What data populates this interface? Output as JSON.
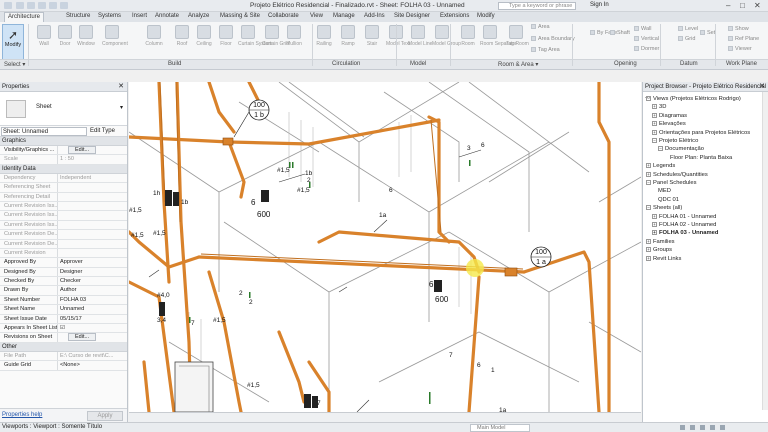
{
  "window": {
    "title": "Projeto Elétrico Residencial - Finalizado.rvt - Sheet: FOLHA 03 - Unnamed",
    "search_placeholder": "Type a keyword or phrase",
    "user": "Sign In"
  },
  "tabs": [
    "Architecture",
    "Structure",
    "Systems",
    "Insert",
    "Annotate",
    "Analyze",
    "Massing & Site",
    "Collaborate",
    "View",
    "Manage",
    "Add-Ins",
    "Site Designer",
    "Extensions",
    "Modify"
  ],
  "active_tab": "Architecture",
  "ribbon": {
    "modify_label": "Modify",
    "tools": [
      "Wall",
      "Door",
      "Window",
      "Component",
      "Column",
      "Roof",
      "Ceiling",
      "Floor",
      "Curtain System",
      "Curtain Grid",
      "Mullion",
      "Railing",
      "Ramp",
      "Stair",
      "Model Text",
      "Model Line",
      "Model Group",
      "Room",
      "Room Separator",
      "Tag Room",
      "Area",
      "Area Boundary",
      "Tag Area",
      "By Face",
      "Shaft",
      "Wall",
      "Vertical",
      "Dormer",
      "Level",
      "Grid",
      "Set",
      "Show",
      "Ref Plane",
      "Viewer"
    ],
    "group_labels": [
      "Select ▾",
      "Build",
      "Circulation",
      "Model",
      "Room & Area ▾",
      "Opening",
      "Datum",
      "Work Plane"
    ]
  },
  "properties": {
    "header": "Properties",
    "type_name": "Sheet",
    "selector": "Sheet: Unnamed",
    "edit_type": "Edit Type",
    "sections": {
      "graphics": "Graphics",
      "identity": "Identity Data",
      "other": "Other"
    },
    "graphics_rows": [
      {
        "key": "Visibility/Graphics ...",
        "value": "",
        "button": "Edit..."
      },
      {
        "key": "Scale",
        "value": "1 : 50",
        "dim": true
      }
    ],
    "identity_rows": [
      {
        "key": "Dependency",
        "value": "Independent",
        "dim": true
      },
      {
        "key": "Referencing Sheet",
        "value": "",
        "dim": true
      },
      {
        "key": "Referencing Detail",
        "value": "",
        "dim": true
      },
      {
        "key": "Current Revision Iss...",
        "value": "",
        "dim": true
      },
      {
        "key": "Current Revision Iss...",
        "value": "",
        "dim": true
      },
      {
        "key": "Current Revision Iss...",
        "value": "",
        "dim": true
      },
      {
        "key": "Current Revision De...",
        "value": "",
        "dim": true
      },
      {
        "key": "Current Revision De...",
        "value": "",
        "dim": true
      },
      {
        "key": "Current Revision",
        "value": "",
        "dim": true
      },
      {
        "key": "Approved By",
        "value": "Approver"
      },
      {
        "key": "Designed By",
        "value": "Designer"
      },
      {
        "key": "Checked By",
        "value": "Checker"
      },
      {
        "key": "Drawn By",
        "value": "Author"
      },
      {
        "key": "Sheet Number",
        "value": "FOLHA 03"
      },
      {
        "key": "Sheet Name",
        "value": "Unnamed"
      },
      {
        "key": "Sheet Issue Date",
        "value": "05/15/17"
      },
      {
        "key": "Appears In Sheet List",
        "value": "☑"
      },
      {
        "key": "Revisions on Sheet",
        "value": "",
        "button": "Edit..."
      }
    ],
    "other_rows": [
      {
        "key": "File Path",
        "value": "E:\\ Curso de revit\\C...",
        "dim": true
      },
      {
        "key": "Guide Grid",
        "value": "<None>"
      }
    ],
    "help_link": "Properties help",
    "apply": "Apply"
  },
  "drawing": {
    "tags": [
      {
        "top": "100",
        "bottom": "1 b"
      },
      {
        "top": "100",
        "bottom": "1 a"
      }
    ],
    "labels": [
      "1h",
      "1b",
      "6",
      "600",
      "6",
      "600",
      "#1,5",
      "#1,5",
      "#1,5",
      "#1,5",
      "#1,5",
      "#1,5",
      "#1,5",
      "#4,0",
      "3,4",
      "1a",
      "1a",
      "1b",
      "2",
      "2",
      "2",
      "3",
      "6",
      "6",
      "7",
      "7",
      "7",
      "6",
      "1"
    ]
  },
  "project_browser": {
    "header": "Project Browser - Projeto Elétrico Residencial ...",
    "items": [
      {
        "label": "Views (Projetos Elétricos Rodrigo)",
        "level": 0,
        "exp": "−"
      },
      {
        "label": "3D",
        "level": 1,
        "exp": "+"
      },
      {
        "label": "Diagramas",
        "level": 1,
        "exp": "+"
      },
      {
        "label": "Elevações",
        "level": 1,
        "exp": "+"
      },
      {
        "label": "Orientações para Projetos Elétricos",
        "level": 1,
        "exp": "+"
      },
      {
        "label": "Projeto Elétrico",
        "level": 1,
        "exp": "−"
      },
      {
        "label": "Documentação",
        "level": 2,
        "exp": "−"
      },
      {
        "label": "Floor Plan: Planta Baixa",
        "level": 3,
        "exp": ""
      },
      {
        "label": "Legends",
        "level": 0,
        "exp": "+"
      },
      {
        "label": "Schedules/Quantities",
        "level": 0,
        "exp": "+"
      },
      {
        "label": "Panel Schedules",
        "level": 0,
        "exp": "−"
      },
      {
        "label": "MED",
        "level": 1,
        "exp": ""
      },
      {
        "label": "QDC 01",
        "level": 1,
        "exp": ""
      },
      {
        "label": "Sheets (all)",
        "level": 0,
        "exp": "−"
      },
      {
        "label": "FOLHA 01 - Unnamed",
        "level": 1,
        "exp": "+"
      },
      {
        "label": "FOLHA 02 - Unnamed",
        "level": 1,
        "exp": "+"
      },
      {
        "label": "FOLHA 03 - Unnamed",
        "level": 1,
        "exp": "+",
        "bold": true
      },
      {
        "label": "Families",
        "level": 0,
        "exp": "+"
      },
      {
        "label": "Groups",
        "level": 0,
        "exp": "+"
      },
      {
        "label": "Revit Links",
        "level": 0,
        "exp": "+"
      }
    ]
  },
  "status": {
    "text": "Viewports : Viewport : Somente Título",
    "model": "Main Model"
  }
}
